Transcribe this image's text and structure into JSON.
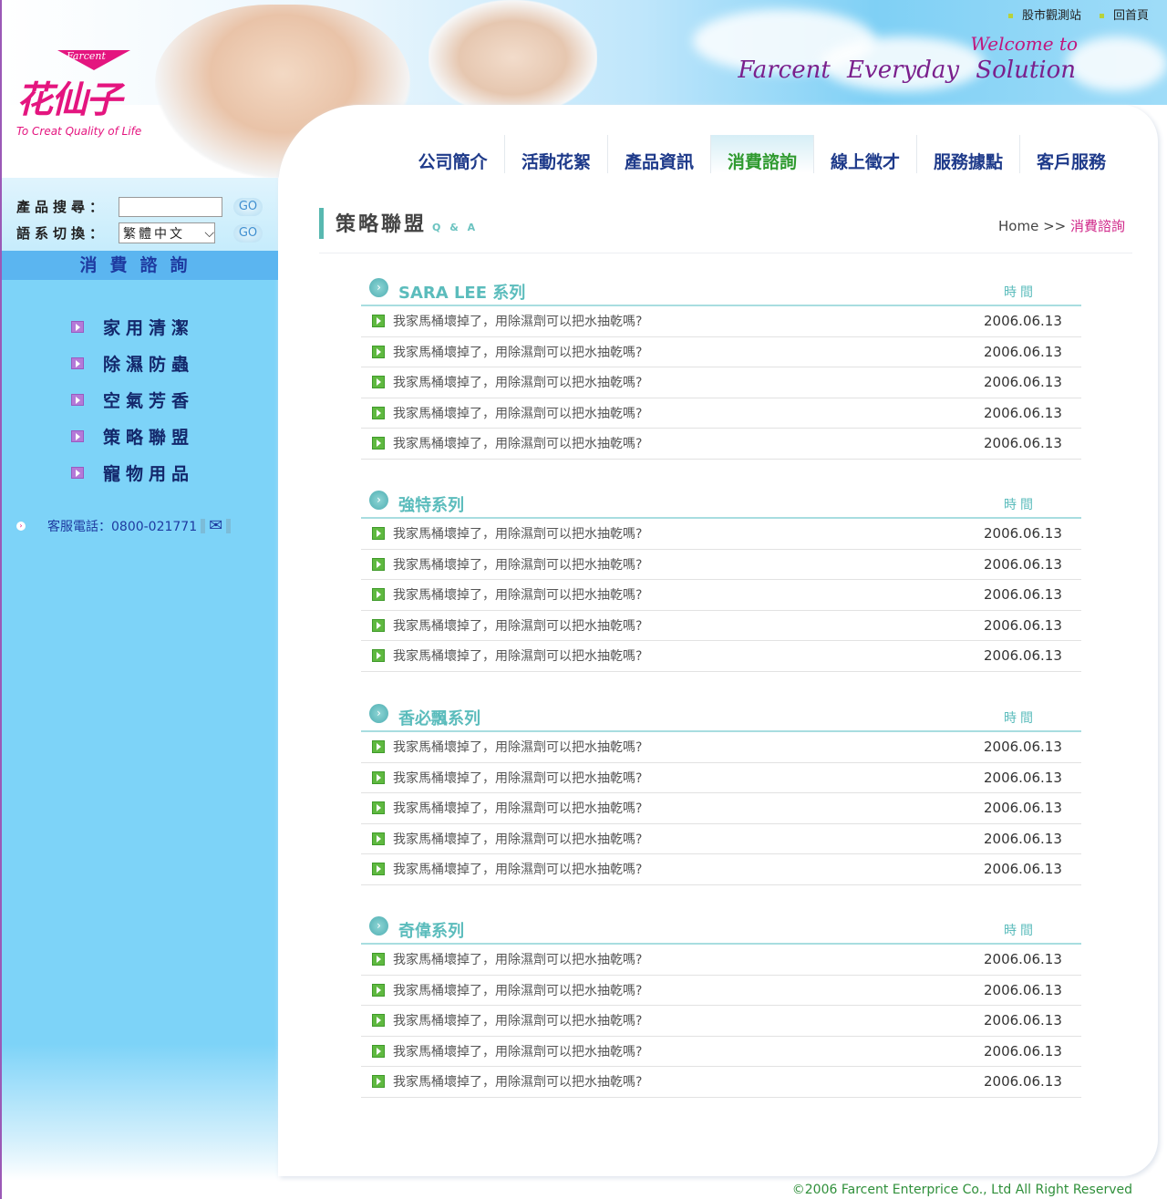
{
  "header": {
    "logo_brand": "花仙子",
    "logo_mark": "Farcent",
    "tagline": "To Creat Quality of Life",
    "welcome": "Welcome to",
    "slogan": "Farcent Everyday Solution",
    "top_links": [
      "股市觀測站",
      "回首頁"
    ]
  },
  "nav": {
    "tabs": [
      "公司簡介",
      "活動花絮",
      "產品資訊",
      "消費諮詢",
      "線上徵才",
      "服務據點",
      "客戶服務"
    ],
    "active": 3
  },
  "sidebar": {
    "search_label": "產品搜尋：",
    "search_value": "",
    "go": "GO",
    "lang_label": "語系切換：",
    "lang_value": "繁體中文",
    "section_title": "消費諮詢",
    "items": [
      "家用清潔",
      "除濕防蟲",
      "空氣芳香",
      "策略聯盟",
      "寵物用品"
    ],
    "phone": "客服電話：0800-021771"
  },
  "page": {
    "title": "策略聯盟",
    "subtitle": "Q & A",
    "breadcrumb_home": "Home >>",
    "breadcrumb_current": "消費諮詢"
  },
  "time_header": "時間",
  "sections": [
    {
      "title": "SARA LEE 系列",
      "rows": [
        {
          "q": "我家馬桶壞掉了，用除濕劑可以把水抽乾嗎?",
          "date": "2006.06.13"
        },
        {
          "q": "我家馬桶壞掉了，用除濕劑可以把水抽乾嗎?",
          "date": "2006.06.13"
        },
        {
          "q": "我家馬桶壞掉了，用除濕劑可以把水抽乾嗎?",
          "date": "2006.06.13"
        },
        {
          "q": "我家馬桶壞掉了，用除濕劑可以把水抽乾嗎?",
          "date": "2006.06.13"
        },
        {
          "q": "我家馬桶壞掉了，用除濕劑可以把水抽乾嗎?",
          "date": "2006.06.13"
        }
      ]
    },
    {
      "title": "強特系列",
      "rows": [
        {
          "q": "我家馬桶壞掉了，用除濕劑可以把水抽乾嗎?",
          "date": "2006.06.13"
        },
        {
          "q": "我家馬桶壞掉了，用除濕劑可以把水抽乾嗎?",
          "date": "2006.06.13"
        },
        {
          "q": "我家馬桶壞掉了，用除濕劑可以把水抽乾嗎?",
          "date": "2006.06.13"
        },
        {
          "q": "我家馬桶壞掉了，用除濕劑可以把水抽乾嗎?",
          "date": "2006.06.13"
        },
        {
          "q": "我家馬桶壞掉了，用除濕劑可以把水抽乾嗎?",
          "date": "2006.06.13"
        }
      ]
    },
    {
      "title": "香必飄系列",
      "rows": [
        {
          "q": "我家馬桶壞掉了，用除濕劑可以把水抽乾嗎?",
          "date": "2006.06.13"
        },
        {
          "q": "我家馬桶壞掉了，用除濕劑可以把水抽乾嗎?",
          "date": "2006.06.13"
        },
        {
          "q": "我家馬桶壞掉了，用除濕劑可以把水抽乾嗎?",
          "date": "2006.06.13"
        },
        {
          "q": "我家馬桶壞掉了，用除濕劑可以把水抽乾嗎?",
          "date": "2006.06.13"
        },
        {
          "q": "我家馬桶壞掉了，用除濕劑可以把水抽乾嗎?",
          "date": "2006.06.13"
        }
      ]
    },
    {
      "title": "奇偉系列",
      "rows": [
        {
          "q": "我家馬桶壞掉了，用除濕劑可以把水抽乾嗎?",
          "date": "2006.06.13"
        },
        {
          "q": "我家馬桶壞掉了，用除濕劑可以把水抽乾嗎?",
          "date": "2006.06.13"
        },
        {
          "q": "我家馬桶壞掉了，用除濕劑可以把水抽乾嗎?",
          "date": "2006.06.13"
        },
        {
          "q": "我家馬桶壞掉了，用除濕劑可以把水抽乾嗎?",
          "date": "2006.06.13"
        },
        {
          "q": "我家馬桶壞掉了，用除濕劑可以把水抽乾嗎?",
          "date": "2006.06.13"
        }
      ]
    }
  ],
  "footer": "©2006 Farcent Enterprice Co., Ltd All Right Reserved",
  "colors": {
    "brand": "#e4157f",
    "sidebar": "#7dd3f8",
    "accent": "#5bbcbc",
    "nav": "#1e3a8a",
    "nav_active": "#2f9a2f"
  }
}
